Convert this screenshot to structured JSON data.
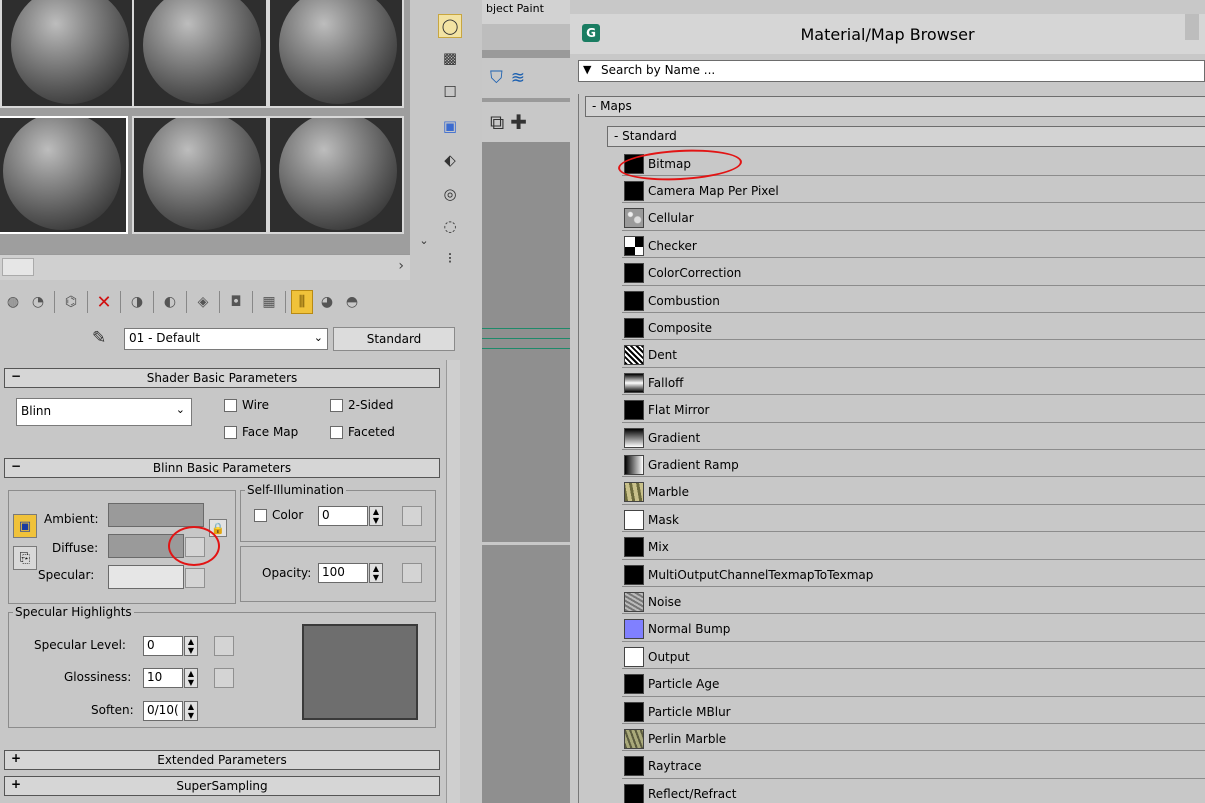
{
  "editor": {
    "material_name": "01 - Default",
    "material_type": "Standard",
    "shader_rollout": {
      "sign": "−",
      "title": "Shader Basic Parameters"
    },
    "shader_type": "Blinn",
    "checks": {
      "wire": "Wire",
      "two_sided": "2-Sided",
      "face_map": "Face Map",
      "faceted": "Faceted"
    },
    "blinn_rollout": {
      "sign": "−",
      "title": "Blinn Basic Parameters"
    },
    "self_illum": {
      "title": "Self-Illumination",
      "color_label": "Color",
      "value": "0"
    },
    "color_labels": {
      "ambient": "Ambient:",
      "diffuse": "Diffuse:",
      "specular": "Specular:"
    },
    "opacity": {
      "label": "Opacity:",
      "value": "100"
    },
    "spec_highlights": {
      "title": "Specular Highlights",
      "level_label": "Specular Level:",
      "level_value": "0",
      "gloss_label": "Glossiness:",
      "gloss_value": "10",
      "soften_label": "Soften:",
      "soften_value": "0/10("
    },
    "extended_rollout": {
      "sign": "+",
      "title": "Extended Parameters"
    },
    "supersampling_rollout": {
      "sign": "+",
      "title": "SuperSampling"
    }
  },
  "viewport": {
    "title": "bject Paint"
  },
  "browser": {
    "title": "Material/Map Browser",
    "app_icon": "G",
    "search_placeholder": "Search by Name ...",
    "category": "- Maps",
    "subcategory": "- Standard",
    "maps": [
      {
        "name": "Bitmap",
        "thumb": "#000000"
      },
      {
        "name": "Camera Map Per Pixel",
        "thumb": "#000000"
      },
      {
        "name": "Cellular",
        "thumb": "cellular"
      },
      {
        "name": "Checker",
        "thumb": "checker"
      },
      {
        "name": "ColorCorrection",
        "thumb": "#000000"
      },
      {
        "name": "Combustion",
        "thumb": "#000000"
      },
      {
        "name": "Composite",
        "thumb": "#000000"
      },
      {
        "name": "Dent",
        "thumb": "dent"
      },
      {
        "name": "Falloff",
        "thumb": "falloff"
      },
      {
        "name": "Flat Mirror",
        "thumb": "#000000"
      },
      {
        "name": "Gradient",
        "thumb": "gradient"
      },
      {
        "name": "Gradient Ramp",
        "thumb": "ramp"
      },
      {
        "name": "Marble",
        "thumb": "marble"
      },
      {
        "name": "Mask",
        "thumb": "#ffffff"
      },
      {
        "name": "Mix",
        "thumb": "#000000"
      },
      {
        "name": "MultiOutputChannelTexmapToTexmap",
        "thumb": "#000000"
      },
      {
        "name": "Noise",
        "thumb": "noise"
      },
      {
        "name": "Normal Bump",
        "thumb": "#8080ff"
      },
      {
        "name": "Output",
        "thumb": "#ffffff"
      },
      {
        "name": "Particle Age",
        "thumb": "#000000"
      },
      {
        "name": "Particle MBlur",
        "thumb": "#000000"
      },
      {
        "name": "Perlin Marble",
        "thumb": "perlin"
      },
      {
        "name": "Raytrace",
        "thumb": "#000000"
      },
      {
        "name": "Reflect/Refract",
        "thumb": "#000000"
      }
    ]
  },
  "colors": {
    "annotation": "#e21414",
    "accent": "#1a7d62"
  }
}
